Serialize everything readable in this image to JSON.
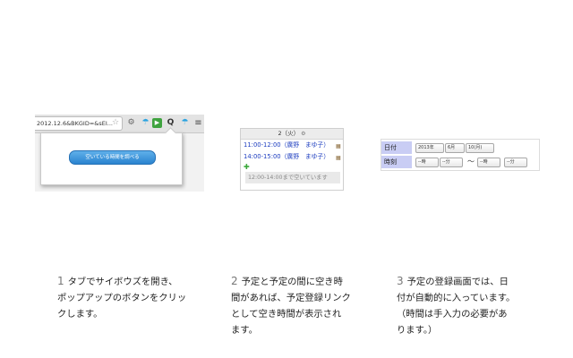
{
  "panel1": {
    "url_text": "2012.12.6&BKGID=&sEI...",
    "star_icon": "☆",
    "icons": [
      "gear-icon",
      "umbrella-icon",
      "play-icon",
      "search-icon",
      "umbrella-icon",
      "menu-icon"
    ],
    "gear_glyph": "⚙",
    "umbrella_glyph": "☂",
    "play_glyph": "▶",
    "search_glyph": "Q",
    "menu_glyph": "≡",
    "popup_button_label": "空いている時間を調べる",
    "button_color": "#2a83cf"
  },
  "panel2": {
    "day_header": "2（火）",
    "header_icon": "⚙",
    "events": [
      {
        "time": "11:00-12:00",
        "name": "（廣野　まゆ子）",
        "icon": "▦"
      },
      {
        "time": "14:00-15:00",
        "name": "（廣野　まゆ子）",
        "icon": "▦"
      }
    ],
    "add_icon": "✚",
    "free_slot": "12:00-14:00まで空いています",
    "event_color": "#1f3fc0"
  },
  "panel3": {
    "date_label": "日付",
    "time_label": "時刻",
    "year": "2013年",
    "month": "6月",
    "day": "10(月)",
    "hour_placeholder": "--時",
    "minute_placeholder": "--分",
    "range_sep": "〜",
    "label_bg": "#c9cdf4"
  },
  "captions": [
    {
      "num": "1",
      "lines": [
        "タブでサイボウズを開き、",
        "ポップアップのボタンをクリッ",
        "クします。"
      ]
    },
    {
      "num": "2",
      "lines": [
        "予定と予定の間に空き時",
        "間があれば、予定登録リンク",
        "として空き時間が表示され",
        "ます。"
      ]
    },
    {
      "num": "3",
      "lines": [
        "予定の登録画面では、日",
        "付が自動的に入っています。",
        "（時間は手入力の必要があ",
        "ります。）"
      ]
    }
  ]
}
